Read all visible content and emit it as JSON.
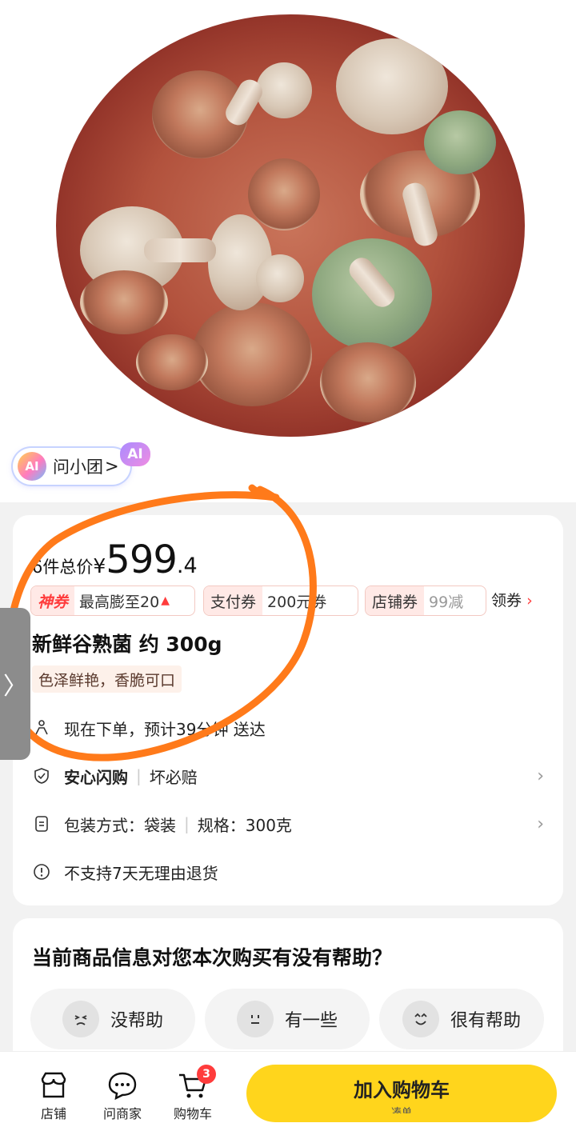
{
  "hero": {
    "image_alt": "fresh mushrooms on red plate"
  },
  "ai_assistant": {
    "logo": "AI",
    "label": "问小团",
    "chevron": ">",
    "badge": "AI"
  },
  "price": {
    "prefix": "6件总价",
    "currency": "¥",
    "integer": "599",
    "decimal": ".4"
  },
  "coupons": [
    {
      "tag": "神券",
      "value": "最高膨至20",
      "icon": "up-arrow-icon"
    },
    {
      "tag": "支付券",
      "value": "200元券"
    },
    {
      "tag": "店铺券",
      "value": "99减"
    }
  ],
  "get_coupon": "领券",
  "product": {
    "title": "新鲜谷熟菌 约 300g",
    "tag": "色泽鲜艳，香脆可口"
  },
  "info": {
    "delivery": "现在下单，预计39分钟 送达",
    "guarantee": "安心闪购",
    "guarantee_desc": "坏必赔",
    "packaging": "包装方式：袋装",
    "spec": "规格：300克",
    "return_policy": "不支持7天无理由退货"
  },
  "feedback": {
    "question": "当前商品信息对您本次购买有没有帮助？",
    "options": [
      "没帮助",
      "有一些",
      "很有帮助"
    ]
  },
  "bottom_bar": {
    "store": "店铺",
    "ask_merchant": "问商家",
    "cart": "购物车",
    "cart_count": "3",
    "add_to_cart": "加入购物车",
    "add_to_cart_sub": "凑单"
  },
  "colors": {
    "accent": "#ffd51c",
    "red": "#ff3c3c",
    "scribble": "#ff7a1a"
  }
}
